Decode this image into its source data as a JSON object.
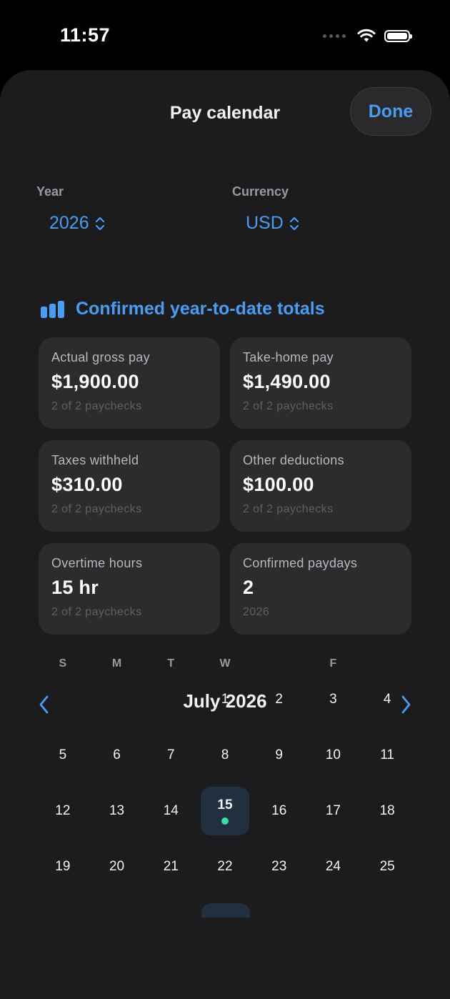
{
  "status_bar": {
    "time": "11:57"
  },
  "header": {
    "title": "Pay calendar",
    "done_label": "Done"
  },
  "pickers": {
    "year": {
      "label": "Year",
      "value": "2026"
    },
    "currency": {
      "label": "Currency",
      "value": "USD"
    }
  },
  "summary": {
    "title": "Confirmed year-to-date totals",
    "cards": [
      {
        "label": "Actual gross pay",
        "value": "$1,900.00",
        "sub": "2 of 2 paychecks"
      },
      {
        "label": "Take-home pay",
        "value": "$1,490.00",
        "sub": "2 of 2 paychecks"
      },
      {
        "label": "Taxes withheld",
        "value": "$310.00",
        "sub": "2 of 2 paychecks"
      },
      {
        "label": "Other deductions",
        "value": "$100.00",
        "sub": "2 of 2 paychecks"
      },
      {
        "label": "Overtime hours",
        "value": "15 hr",
        "sub": "2 of 2 paychecks"
      },
      {
        "label": "Confirmed paydays",
        "value": "2",
        "sub": "2026"
      }
    ]
  },
  "calendar": {
    "month_title": "July 2026",
    "weekdays": [
      "S",
      "M",
      "T",
      "W",
      "",
      "F",
      ""
    ],
    "leading_blanks": 3,
    "days": [
      "1",
      "2",
      "3",
      "4",
      "5",
      "6",
      "7",
      "8",
      "9",
      "10",
      "11",
      "12",
      "13",
      "14",
      "15",
      "16",
      "17",
      "18",
      "19",
      "20",
      "21",
      "22",
      "23",
      "24",
      "25"
    ],
    "selected_day": "15",
    "pay_days": [
      "15"
    ]
  },
  "colors": {
    "accent": "#4a9cf2",
    "payday_dot": "#3dd9a8",
    "sheet_bg": "#1c1c1e",
    "card_bg": "#2c2c2e"
  }
}
